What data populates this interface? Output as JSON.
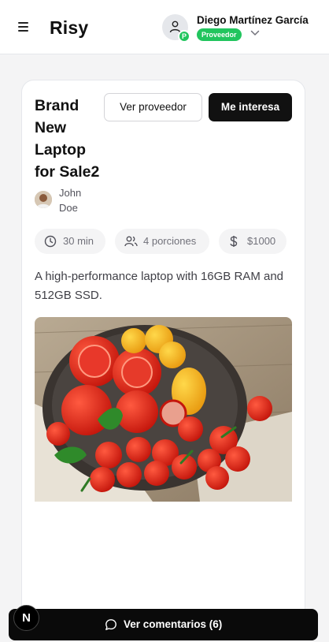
{
  "header": {
    "brand": "Risy",
    "user_name": "Diego Martínez García",
    "avatar_badge": "P",
    "role_badge": "Proveedor"
  },
  "product": {
    "title": "Brand New Laptop for Sale2",
    "author": "John Doe",
    "view_provider_label": "Ver proveedor",
    "interest_label": "Me interesa",
    "stats": {
      "time": "30 min",
      "portions": "4 porciones",
      "price": "$1000"
    },
    "description": "A high-performance laptop with 16GB RAM and 512GB SSD."
  },
  "footer": {
    "comments_label": "Ver comentarios (6)",
    "dev_badge": "N"
  },
  "icons": {
    "menu": "hamburger-icon",
    "user": "user-icon",
    "chevron": "chevron-down-icon",
    "clock": "clock-icon",
    "people": "users-icon",
    "dollar": "dollar-icon",
    "comment": "message-circle-icon"
  },
  "colors": {
    "accent_green": "#22c55e",
    "primary_dark": "#111111"
  }
}
